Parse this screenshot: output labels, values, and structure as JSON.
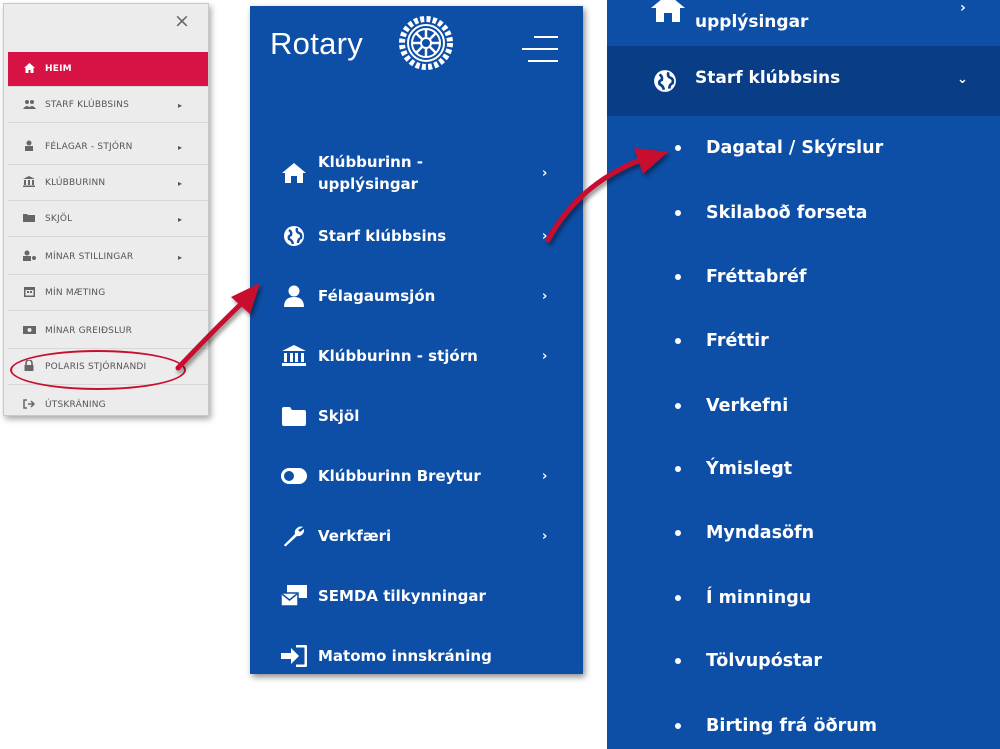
{
  "old_menu": {
    "close_glyph": "×",
    "items": [
      {
        "label": "HEIM",
        "icon": "home-icon",
        "glyph": "⌂",
        "active": true,
        "arrow": false
      },
      {
        "label": "STARF KLÚBBSINS",
        "icon": "people-icon",
        "glyph": "⚇",
        "arrow": true
      },
      {
        "label": "FÉLAGAR - STJÓRN",
        "icon": "user-icon",
        "glyph": "♙",
        "arrow": true
      },
      {
        "label": "KLÚBBURINN",
        "icon": "bank-icon",
        "glyph": "⌂",
        "arrow": true
      },
      {
        "label": "SKJÖL",
        "icon": "folder-icon",
        "glyph": "▬",
        "arrow": true
      },
      {
        "label": "MÍNAR STILLINGAR",
        "icon": "user-settings-icon",
        "glyph": "♙",
        "arrow": true
      },
      {
        "label": "MÍN MÆTING",
        "icon": "calendar-icon",
        "glyph": "▦",
        "arrow": false
      },
      {
        "label": "MÍNAR GREIÐSLUR",
        "icon": "money-icon",
        "glyph": "▭",
        "arrow": false
      },
      {
        "label": "POLARIS STJÓRNANDI",
        "icon": "lock-icon",
        "glyph": "🔒",
        "arrow": false
      },
      {
        "label": "ÚTSKRÁNING",
        "icon": "sign-out-icon",
        "glyph": "⇥",
        "arrow": false
      }
    ],
    "arrow_glyph": "▸"
  },
  "rotary_menu": {
    "brand": "Rotary",
    "items": [
      {
        "label_line1": "Klúbburinn -",
        "label_line2": "upplýsingar",
        "icon": "home-icon",
        "chevron": true
      },
      {
        "label": "Starf klúbbsins",
        "icon": "globe-icon",
        "chevron": true
      },
      {
        "label": "Félagaumsjón",
        "icon": "user-icon",
        "chevron": true
      },
      {
        "label": "Klúbburinn - stjórn",
        "icon": "bank-icon",
        "chevron": true
      },
      {
        "label": "Skjöl",
        "icon": "folder-icon",
        "chevron": false
      },
      {
        "label": "Klúbburinn Breytur",
        "icon": "toggle-icon",
        "chevron": true
      },
      {
        "label": "Verkfæri",
        "icon": "wrench-icon",
        "chevron": true
      },
      {
        "label": "SEMDA tilkynningar",
        "icon": "mail-bulk-icon",
        "chevron": false
      },
      {
        "label": "Matomo innskráning",
        "icon": "sign-in-icon",
        "chevron": false
      }
    ],
    "chevron_glyph": "›"
  },
  "submenu": {
    "top_label": "upplýsingar",
    "top_chevron": "›",
    "active_label": "Starf klúbbsins",
    "active_chevron": "⌄",
    "items": [
      "Dagatal / Skýrslur",
      "Skilaboð forseta",
      "Fréttabréf",
      "Fréttir",
      "Verkefni",
      "Ýmislegt",
      "Myndasöfn",
      "Í minningu",
      "Tölvupóstar",
      "Birting frá öðrum"
    ]
  },
  "colors": {
    "rotary_blue": "#0d4ea6",
    "active_blue": "#093d85",
    "heim_red": "#d71346",
    "arrow_red": "#c8102e"
  }
}
